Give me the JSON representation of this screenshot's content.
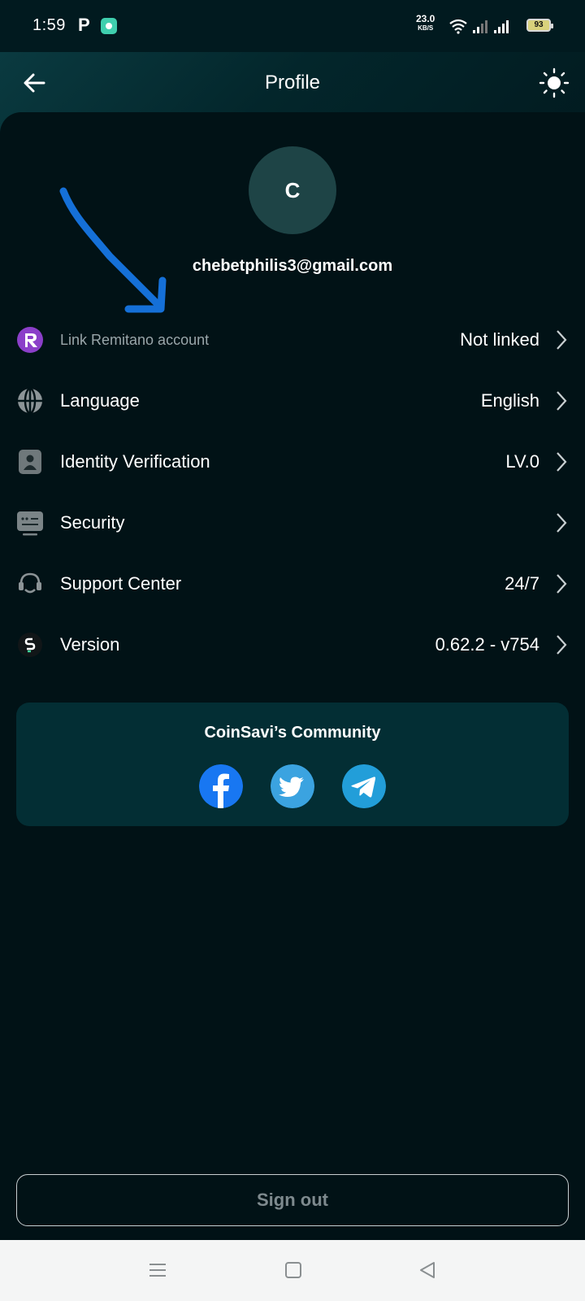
{
  "status_bar": {
    "time": "1:59",
    "notification_app": "P",
    "net_speed_value": "23.0",
    "net_speed_unit": "KB/S",
    "battery": "93"
  },
  "header": {
    "title": "Profile",
    "back_icon": "arrow-left-icon",
    "theme_icon": "sun-icon"
  },
  "profile": {
    "avatar_initial": "C",
    "email": "chebetphilis3@gmail.com"
  },
  "menu": [
    {
      "label": "Link Remitano account",
      "value": "Not linked",
      "icon": "remitano-icon"
    },
    {
      "label": "Language",
      "value": "English",
      "icon": "globe-icon"
    },
    {
      "label": "Identity Verification",
      "value": "LV.0",
      "icon": "id-badge-icon"
    },
    {
      "label": "Security",
      "value": "",
      "icon": "keypad-icon"
    },
    {
      "label": "Support Center",
      "value": "24/7",
      "icon": "headset-icon"
    },
    {
      "label": "Version",
      "value": "0.62.2 - v754",
      "icon": "app-logo-icon"
    }
  ],
  "community": {
    "title": "CoinSavi’s Community",
    "links": [
      "facebook-icon",
      "twitter-icon",
      "telegram-icon"
    ]
  },
  "sign_out_label": "Sign out",
  "colors": {
    "background": "#011216",
    "card": "#032e34",
    "avatar": "#1e4446",
    "annotation_arrow": "#1a73e8"
  }
}
